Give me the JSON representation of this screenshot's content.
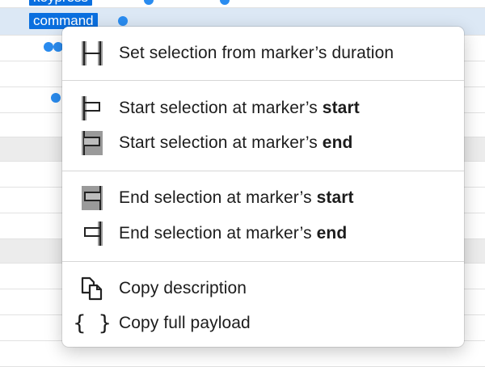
{
  "timeline": {
    "markers": [
      {
        "label": "keypress"
      },
      {
        "label": "command"
      }
    ]
  },
  "menu": {
    "items": [
      {
        "name": "set-selection-from-duration",
        "text": "Set selection from marker’s duration",
        "bold": ""
      },
      {
        "name": "start-selection-at-start",
        "text": "Start selection at marker’s ",
        "bold": "start"
      },
      {
        "name": "start-selection-at-end",
        "text": "Start selection at marker’s ",
        "bold": "end"
      },
      {
        "name": "end-selection-at-start",
        "text": "End selection at marker’s ",
        "bold": "start"
      },
      {
        "name": "end-selection-at-end",
        "text": "End selection at marker’s ",
        "bold": "end"
      },
      {
        "name": "copy-description",
        "text": "Copy description",
        "bold": ""
      },
      {
        "name": "copy-full-payload",
        "text": "Copy full payload",
        "bold": ""
      }
    ],
    "icons": {
      "duration": "duration-bracket-icon",
      "start_at_start": "flag-start-icon",
      "start_at_end": "flag-start-end-icon",
      "end_at_start": "flag-end-start-icon",
      "end_at_end": "flag-end-icon",
      "copy": "copy-document-icon",
      "payload": "curly-braces-icon"
    }
  },
  "colors": {
    "accent": "#0a6fdf",
    "selected_row": "#dce8f5",
    "dot": "#2a8cf0"
  }
}
